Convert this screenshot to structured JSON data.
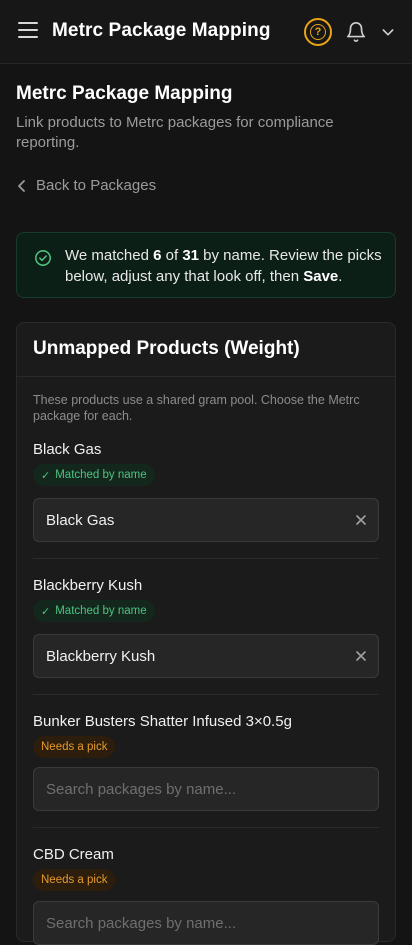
{
  "app": {
    "title": "Metrc Package Mapping"
  },
  "header": {
    "title": "Metrc Package Mapping",
    "subtitle": "Link products to Metrc packages for compliance reporting.",
    "back_label": "Back to Packages"
  },
  "notice": {
    "prefix": "We matched ",
    "matched": "6",
    "of": " of ",
    "total": "31",
    "middle": " by name. Review the picks below, adjust any that look off, then ",
    "action": "Save",
    "suffix": ".",
    "color": "#4ec27f"
  },
  "section": {
    "title": "Unmapped Products (Weight)",
    "description": "These products use a shared gram pool. Choose the Metrc package for each."
  },
  "products": [
    {
      "name": "Black Gas",
      "status": "Matched by name",
      "value": "Black Gas"
    },
    {
      "name": "Blackberry Kush",
      "status": "Matched by name",
      "value": "Blackberry Kush"
    },
    {
      "name": "Bunker Busters Shatter Infused 3×0.5g",
      "status": "Needs a pick",
      "placeholder": "Search packages by name..."
    },
    {
      "name": "CBD Cream",
      "status": "Needs a pick",
      "placeholder": "Search packages by name..."
    }
  ],
  "icons": {
    "menu": "menu-icon",
    "help": "help-icon",
    "bell": "bell-icon",
    "chevron": "chevron-down-icon",
    "back": "chevron-left-icon",
    "check": "check-circle-icon",
    "clear": "close-icon"
  },
  "colors": {
    "accent": "#e9a516",
    "success": "#4ec27f",
    "warning": "#e59a2b"
  }
}
